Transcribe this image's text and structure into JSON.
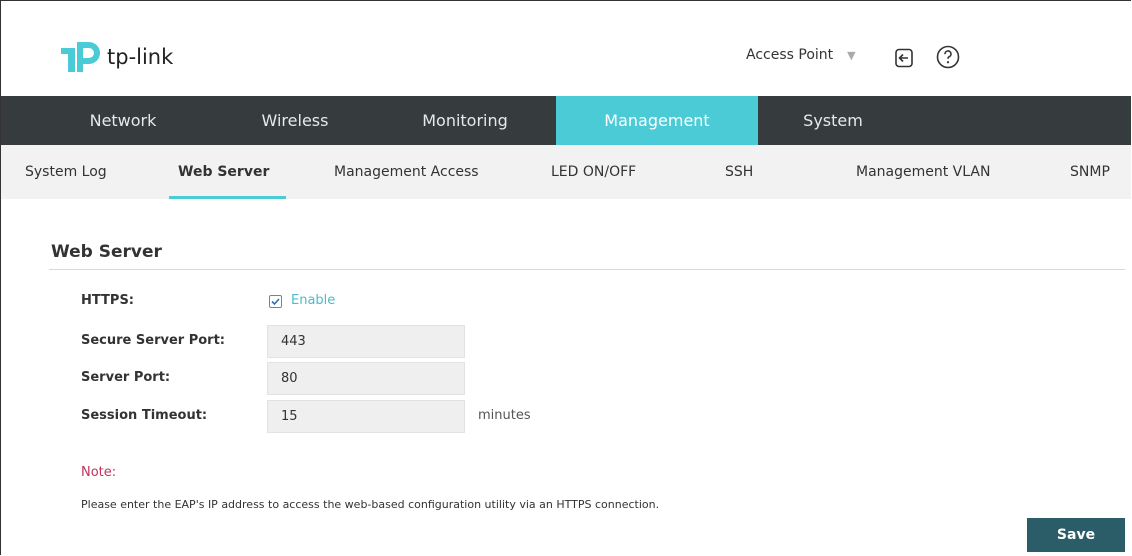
{
  "header": {
    "logo_text": "tp-link",
    "mode_label": "Access Point",
    "mode_caret": "⌄"
  },
  "mainnav": {
    "tabs": [
      {
        "label": "Network"
      },
      {
        "label": "Wireless"
      },
      {
        "label": "Monitoring"
      },
      {
        "label": "Management",
        "active": true
      },
      {
        "label": "System"
      }
    ]
  },
  "subnav": {
    "items": [
      {
        "label": "System Log"
      },
      {
        "label": "Web Server",
        "active": true
      },
      {
        "label": "Management Access"
      },
      {
        "label": "LED ON/OFF"
      },
      {
        "label": "SSH"
      },
      {
        "label": "Management VLAN"
      },
      {
        "label": "SNMP"
      }
    ]
  },
  "content": {
    "section_title": "Web Server",
    "https_label": "HTTPS:",
    "https_enable_label": "Enable",
    "https_enabled": true,
    "secure_port_label": "Secure Server Port:",
    "secure_port_value": "443",
    "server_port_label": "Server Port:",
    "server_port_value": "80",
    "session_timeout_label": "Session Timeout:",
    "session_timeout_value": "15",
    "session_timeout_unit": "minutes",
    "note_title": "Note:",
    "note_text": "Please enter the EAP's IP address to access the web-based configuration utility via an HTTPS connection.",
    "save_label": "Save"
  },
  "colors": {
    "accent": "#4acbd6",
    "nav_bg": "#363c3e",
    "subnav_bg": "#f2f2f2",
    "save_bg": "#2a5d68",
    "note_color": "#c0345e"
  },
  "icons": {
    "logo": "tp-link-logo-icon",
    "logout": "logout-icon",
    "help": "help-icon",
    "checkbox": "checkbox-checked-icon"
  }
}
